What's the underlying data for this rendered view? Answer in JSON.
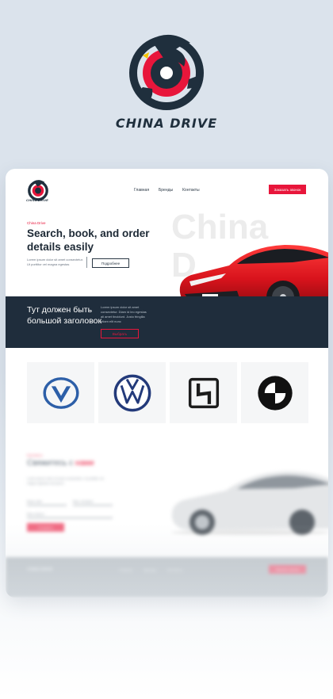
{
  "brand": {
    "name": "CHINA DRIVE",
    "logo_icon": "dragon-wheel-logo",
    "colors": {
      "navy": "#1f2f3d",
      "red": "#e8163b"
    }
  },
  "site": {
    "nav": {
      "logo_text": "CHINA DRIVE",
      "links": [
        "Главная",
        "Бренды",
        "Контакты"
      ],
      "cta": "Заказать звонок"
    },
    "hero": {
      "eyebrow": "China Drive",
      "bg_word_1": "China",
      "bg_word_2": "D",
      "title": "Search, book, and order details easily",
      "description": "Lorem ipsum dolor sit amet consectetur. Ut porttitor vel magna egestas",
      "button": "Подробнее",
      "car_plate": "MG MULAN"
    },
    "banner": {
      "title": "Тут должен быть большой заголовок",
      "text": "Lorem ipsum dolor sit amet consectetur. Diam id leo egestas ali amet tincidunt. Justo fringilla etiam elit nunc",
      "button": "Выбрать"
    },
    "brands": [
      {
        "name": "changan",
        "icon": "changan-logo-icon"
      },
      {
        "name": "volkswagen",
        "icon": "volkswagen-logo-icon"
      },
      {
        "name": "geely",
        "icon": "geely-logo-icon"
      },
      {
        "name": "bmw",
        "icon": "bmw-logo-icon"
      }
    ],
    "contact": {
      "eyebrow": "Контакты",
      "title_main": "Свяжитесь с ",
      "title_accent": "нами",
      "description": "Lorem ipsum dolor sit amet consectetur. Ut porttitor vel magna egestas sed ipsum",
      "name_placeholder": "Ваше имя",
      "phone_placeholder": "Ваш телефон",
      "comment_placeholder": "Ваш вопрос",
      "button": "Отправить"
    },
    "footer": {
      "brand": "CHINA DRIVE",
      "links": [
        "Главная",
        "Бренды",
        "Контакты"
      ],
      "button": "Заказать звонок"
    }
  }
}
